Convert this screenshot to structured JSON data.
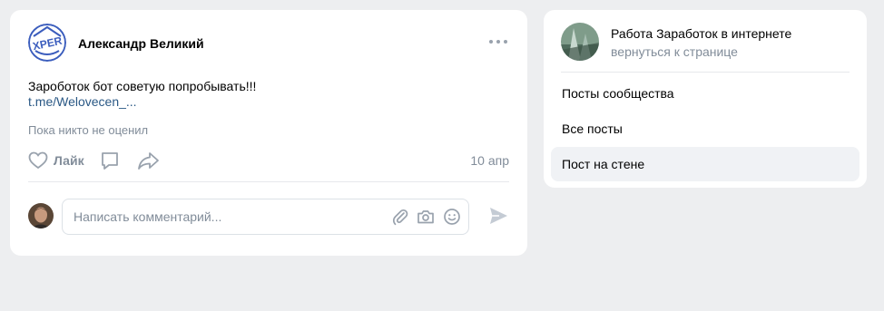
{
  "post": {
    "author": "Александр Великий",
    "avatar_logo_text": "XPER",
    "text": "Зароботок бот советую попробывать!!!",
    "link": "t.me/Welovecen_...",
    "likes_info": "Пока никто не оценил",
    "like_label": "Лайк",
    "date": "10 апр",
    "comment_placeholder": "Написать комментарий..."
  },
  "sidebar": {
    "group_name": "Работа Заработок в интернете",
    "back_link": "вернуться к странице",
    "items": [
      {
        "label": "Посты сообщества"
      },
      {
        "label": "Все посты"
      },
      {
        "label": "Пост на стене"
      }
    ],
    "active_item": "Пост на стене"
  },
  "colors": {
    "background": "#edeef0",
    "card": "#ffffff",
    "link": "#2a5885",
    "muted": "#818c99",
    "icon": "#99a2ad"
  }
}
